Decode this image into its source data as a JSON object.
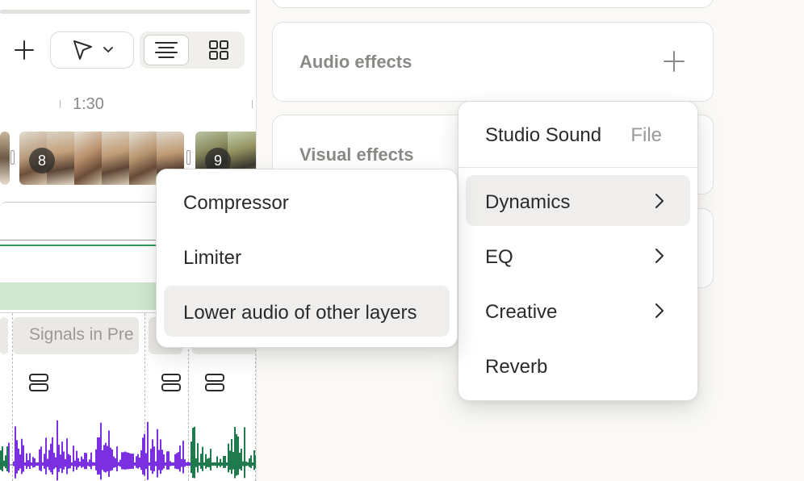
{
  "toolbar": {
    "add_icon": "plus-icon",
    "pointer_icon": "cursor-arrow-icon",
    "dropdown_icon": "chevron-down-icon",
    "view_list_icon": "list-view-icon",
    "view_grid_icon": "grid-view-icon"
  },
  "timeline": {
    "ruler_time": "1:30",
    "scenes": [
      {
        "number": "8"
      },
      {
        "number": "9"
      }
    ],
    "clip_label": "Signals in Pre",
    "waveform_colors": {
      "primary": "#7a2fe0",
      "secondary": "#1f7a4d"
    }
  },
  "sidebar": {
    "audio_effects_title": "Audio effects",
    "visual_effects_title": "Visual effects"
  },
  "effects_menu": {
    "header_title": "Studio Sound",
    "header_secondary": "File",
    "items": [
      {
        "label": "Dynamics",
        "has_submenu": true,
        "active": true
      },
      {
        "label": "EQ",
        "has_submenu": true,
        "active": false
      },
      {
        "label": "Creative",
        "has_submenu": true,
        "active": false
      },
      {
        "label": "Reverb",
        "has_submenu": false,
        "active": false
      }
    ]
  },
  "dynamics_submenu": {
    "items": [
      {
        "label": "Compressor",
        "active": false
      },
      {
        "label": "Limiter",
        "active": false
      },
      {
        "label": "Lower audio of other layers",
        "active": true
      }
    ]
  }
}
